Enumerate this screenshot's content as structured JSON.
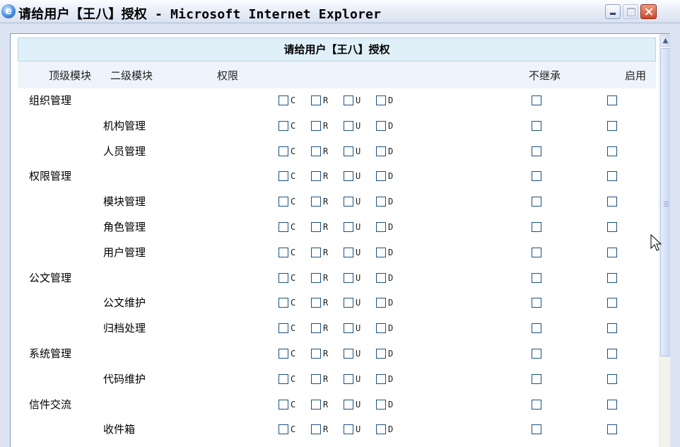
{
  "window": {
    "title": "请给用户【王八】授权 - Microsoft Internet Explorer",
    "icon": "ie-icon"
  },
  "page": {
    "heading": "请给用户【王八】授权",
    "columns": {
      "top_module": "顶级模块",
      "second_module": "二级模块",
      "permission": "权限",
      "no_inherit": "不继承",
      "enable": "启用"
    },
    "perm_letters": [
      "C",
      "R",
      "U",
      "D"
    ],
    "rows": [
      {
        "level1": "组织管理",
        "level2": ""
      },
      {
        "level1": "",
        "level2": "机构管理"
      },
      {
        "level1": "",
        "level2": "人员管理"
      },
      {
        "level1": "权限管理",
        "level2": ""
      },
      {
        "level1": "",
        "level2": "模块管理"
      },
      {
        "level1": "",
        "level2": "角色管理"
      },
      {
        "level1": "",
        "level2": "用户管理"
      },
      {
        "level1": "公文管理",
        "level2": ""
      },
      {
        "level1": "",
        "level2": "公文维护"
      },
      {
        "level1": "",
        "level2": "归档处理"
      },
      {
        "level1": "系统管理",
        "level2": ""
      },
      {
        "level1": "",
        "level2": "代码维护"
      },
      {
        "level1": "信件交流",
        "level2": ""
      },
      {
        "level1": "",
        "level2": "收件箱"
      }
    ]
  }
}
